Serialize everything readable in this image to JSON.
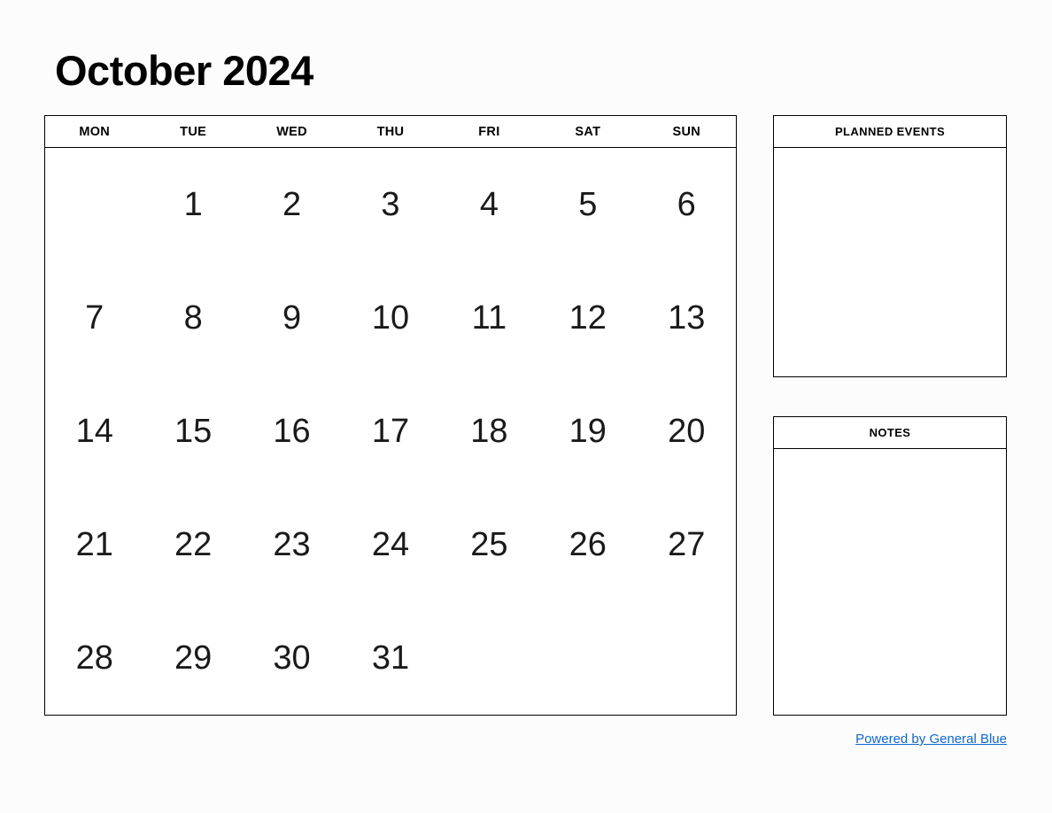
{
  "title": "October 2024",
  "calendar": {
    "weekday_headers": [
      "MON",
      "TUE",
      "WED",
      "THU",
      "FRI",
      "SAT",
      "SUN"
    ],
    "weeks": [
      [
        "",
        "1",
        "2",
        "3",
        "4",
        "5",
        "6"
      ],
      [
        "7",
        "8",
        "9",
        "10",
        "11",
        "12",
        "13"
      ],
      [
        "14",
        "15",
        "16",
        "17",
        "18",
        "19",
        "20"
      ],
      [
        "21",
        "22",
        "23",
        "24",
        "25",
        "26",
        "27"
      ],
      [
        "28",
        "29",
        "30",
        "31",
        "",
        "",
        ""
      ]
    ]
  },
  "panels": {
    "planned_events": {
      "header": "PLANNED EVENTS",
      "content": ""
    },
    "notes": {
      "header": "NOTES",
      "content": ""
    }
  },
  "footer": {
    "link_text": "Powered by General Blue",
    "link_color": "#1267cf"
  }
}
